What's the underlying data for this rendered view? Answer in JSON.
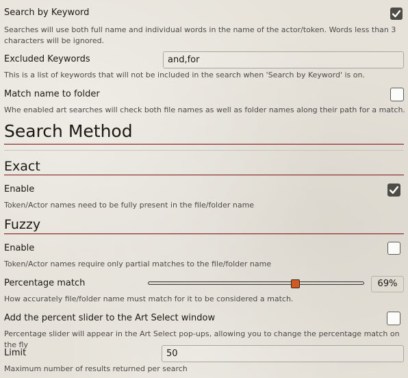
{
  "search_by_keyword": {
    "label": "Search by Keyword",
    "checked": true,
    "hint": "Searches will use both full name and individual words in the name of the actor/token. Words less than 3 characters will be ignored."
  },
  "excluded_keywords": {
    "label": "Excluded Keywords",
    "value": "and,for",
    "hint": "This is a list of keywords that will not be included in the search when 'Search by Keyword' is on."
  },
  "match_name_to_folder": {
    "label": "Match name to folder",
    "checked": false,
    "hint": "Whe enabled art searches will check both file names as well as folder names along their path for a match."
  },
  "search_method": {
    "title": "Search Method"
  },
  "exact": {
    "title": "Exact",
    "enable_label": "Enable",
    "checked": true,
    "hint": "Token/Actor names need to be fully present in the file/folder name"
  },
  "fuzzy": {
    "title": "Fuzzy",
    "enable_label": "Enable",
    "checked": false,
    "hint": "Token/Actor names require only partial matches to the file/folder name",
    "percentage": {
      "label": "Percentage match",
      "value": 69,
      "value_text": "69%",
      "hint": "How accurately file/folder name must match for it to be considered a match."
    },
    "percent_slider": {
      "label": "Add the percent slider to the Art Select window",
      "checked": false,
      "hint": "Percentage slider will appear in the Art Select pop-ups, allowing you to change the percentage match on the fly"
    },
    "limit": {
      "label": "Limit",
      "value": "50",
      "hint": "Maximum number of results returned per search"
    }
  },
  "colors": {
    "accent_rule": "#7a0e0e",
    "slider_thumb": "#d25a20",
    "checkbox_checked": "#4d4c47"
  }
}
